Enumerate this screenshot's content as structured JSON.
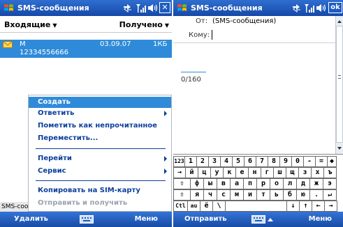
{
  "left": {
    "title": "SMS-сообщения",
    "close_label": "✕",
    "folder": "Входящие",
    "sort": "Получено",
    "message": {
      "sender": "М",
      "date": "03.09.07",
      "size": "1КБ",
      "number": "12334556666"
    },
    "status_text": "SMS-сообщения",
    "menu": {
      "items": [
        {
          "label": "Создать",
          "selected": true
        },
        {
          "label": "Ответить",
          "submenu": true
        },
        {
          "label": "Пометить как непрочитанное"
        },
        {
          "label": "Переместить..."
        },
        {
          "label": "Перейти",
          "submenu": true
        },
        {
          "label": "Сервис",
          "submenu": true
        },
        {
          "label": "Копировать на SIM-карту"
        },
        {
          "label": "Отправить и получить",
          "disabled": true
        }
      ]
    },
    "softkeys": {
      "left": "Удалить",
      "right": "Меню"
    }
  },
  "right": {
    "title": "SMS-сообщения",
    "ok_label": "ok",
    "from_label": "От:",
    "from_value": "(SMS-сообщения)",
    "to_label": "Кому:",
    "to_value": "",
    "char_count": "0/160",
    "softkeys": {
      "left": "Отправить",
      "right": "Меню"
    },
    "keyboard": {
      "rows": [
        [
          "123",
          "1",
          "2",
          "3",
          "4",
          "5",
          "6",
          "7",
          "8",
          "9",
          "0",
          "-",
          "=",
          "◆"
        ],
        [
          "→",
          "й",
          "ц",
          "у",
          "к",
          "е",
          "н",
          "г",
          "ш",
          "щ",
          "з",
          "х",
          "ъ"
        ],
        [
          "⇧",
          "ф",
          "ы",
          "в",
          "а",
          "п",
          "р",
          "о",
          "л",
          "д",
          "ж",
          "э"
        ],
        [
          "⇧",
          "я",
          "ч",
          "с",
          "м",
          "и",
          "т",
          "ь",
          "б",
          "ю",
          ".",
          "↵"
        ],
        [
          "Ctl",
          "au",
          "ё",
          "\\",
          "",
          "↓",
          "↑",
          "←",
          "→"
        ]
      ]
    }
  },
  "colors": {
    "title_bar": "#1d5bc2",
    "selection": "#2f8bd9",
    "menu_text": "#0b3f9c"
  }
}
